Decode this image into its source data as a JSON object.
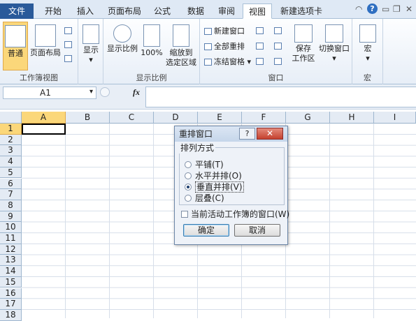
{
  "tabs": {
    "file": "文件",
    "home": "开始",
    "insert": "插入",
    "page_layout": "页面布局",
    "formulas": "公式",
    "data": "数据",
    "review": "审阅",
    "view": "视图",
    "new_tab": "新建选项卡"
  },
  "ribbon": {
    "normal": "普通",
    "page_layout_view": "页面布局",
    "show": "显示",
    "group_workbook_views": "工作簿视图",
    "zoom": "显示比例",
    "zoom100": "100%",
    "zoom_sel_1": "缩放到",
    "zoom_sel_2": "选定区域",
    "group_zoom": "显示比例",
    "new_window": "新建窗口",
    "arrange_all": "全部重排",
    "freeze": "冻结窗格",
    "save_ws_1": "保存",
    "save_ws_2": "工作区",
    "switch_win": "切换窗口",
    "group_window": "窗口",
    "macros": "宏",
    "group_macros": "宏"
  },
  "formula": {
    "name_box": "A1",
    "fx": "fx"
  },
  "sheet": {
    "columns": [
      "A",
      "B",
      "C",
      "D",
      "E",
      "F",
      "G",
      "H",
      "I"
    ],
    "rows": [
      "1",
      "2",
      "3",
      "4",
      "5",
      "6",
      "7",
      "8",
      "9",
      "10",
      "11",
      "12",
      "13",
      "14",
      "15",
      "16",
      "17",
      "18"
    ]
  },
  "dialog": {
    "title": "重排窗口",
    "help": "?",
    "close": "✕",
    "group": "排列方式",
    "options": [
      "平铺(T)",
      "水平并排(O)",
      "垂直并排(V)",
      "层叠(C)"
    ],
    "selected": 2,
    "checkbox": "当前活动工作簿的窗口(W)",
    "ok": "确定",
    "cancel": "取消"
  }
}
